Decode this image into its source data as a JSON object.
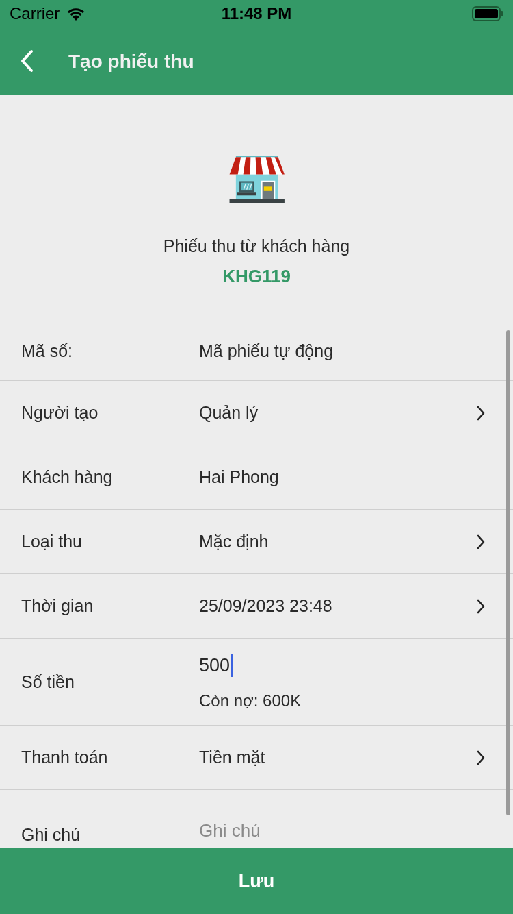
{
  "status_bar": {
    "carrier": "Carrier",
    "time": "11:48 PM"
  },
  "header": {
    "title": "Tạo phiếu thu"
  },
  "customer": {
    "caption": "Phiếu thu từ khách hàng",
    "code": "KHG119"
  },
  "rows": [
    {
      "kind": "static",
      "label": "Mã số:",
      "value": "Mã phiếu tự động"
    },
    {
      "kind": "link",
      "label": "Người tạo",
      "value": "Quản lý"
    },
    {
      "kind": "static",
      "label": "Khách hàng",
      "value": "Hai Phong"
    },
    {
      "kind": "link",
      "label": "Loại thu",
      "value": "Mặc định"
    },
    {
      "kind": "link",
      "label": "Thời gian",
      "value": "25/09/2023 23:48"
    },
    {
      "kind": "amount",
      "label": "Số tiền",
      "value": "500",
      "note": "Còn nợ: 600K"
    },
    {
      "kind": "link",
      "label": "Thanh toán",
      "value": "Tiền mặt"
    },
    {
      "kind": "note",
      "label": "Ghi chú",
      "placeholder": "Ghi chú"
    }
  ],
  "save_button": {
    "label": "Lưu"
  }
}
